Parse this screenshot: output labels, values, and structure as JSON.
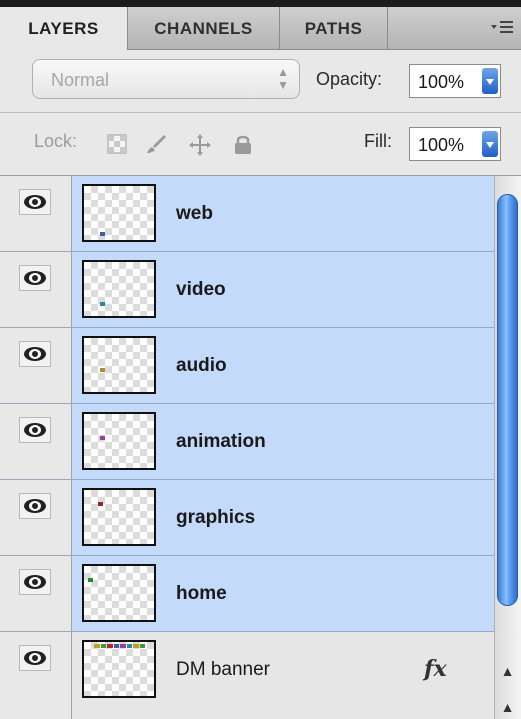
{
  "tabs": [
    {
      "label": "LAYERS",
      "active": true
    },
    {
      "label": "CHANNELS",
      "active": false
    },
    {
      "label": "PATHS",
      "active": false
    }
  ],
  "tab_menu_icon": "panel-menu-icon",
  "blend": {
    "mode": "Normal",
    "opacity_label": "Opacity:",
    "opacity_value": "100%"
  },
  "lock": {
    "label": "Lock:",
    "fill_label": "Fill:",
    "fill_value": "100%",
    "icons": [
      "lock-transparent-icon",
      "lock-image-icon",
      "lock-position-icon",
      "lock-all-icon"
    ]
  },
  "layers": [
    {
      "name": "web",
      "selected": true,
      "dot_color": "#3b5fa0"
    },
    {
      "name": "video",
      "selected": true,
      "dot_color": "#1f8fa0"
    },
    {
      "name": "audio",
      "selected": true,
      "dot_color": "#b08a3a"
    },
    {
      "name": "animation",
      "selected": true,
      "dot_color": "#9a3fa0"
    },
    {
      "name": "graphics",
      "selected": true,
      "dot_color": "#8a2a2a"
    },
    {
      "name": "home",
      "selected": true,
      "dot_color": "#2a8a2a"
    },
    {
      "name": "DM banner",
      "selected": false,
      "fx": "fx"
    }
  ],
  "colors": {
    "selection": "#c3dafa",
    "accent": "#1f5fc8"
  }
}
